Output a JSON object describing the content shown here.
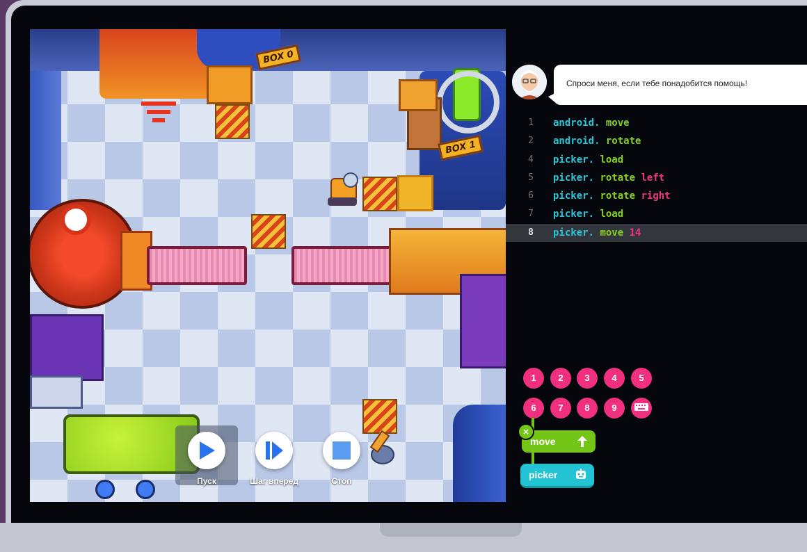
{
  "game": {
    "box_labels": [
      "BOX 0",
      "BOX 1"
    ],
    "controls": [
      {
        "label": "Пуск",
        "icon": "play-icon"
      },
      {
        "label": "Шаг вперед",
        "icon": "step-forward-icon"
      },
      {
        "label": "Стоп",
        "icon": "stop-icon"
      }
    ]
  },
  "assistant": {
    "message": "Спроси меня, если тебе понадобится помощь!",
    "icon": "professor-avatar"
  },
  "code": {
    "lines": [
      {
        "num": "1",
        "obj": "android.",
        "method": "move",
        "arg": ""
      },
      {
        "num": "2",
        "obj": "android.",
        "method": "rotate",
        "arg": ""
      },
      {
        "num": "4",
        "obj": "picker.",
        "method": "load",
        "arg": ""
      },
      {
        "num": "5",
        "obj": "picker.",
        "method": "rotate",
        "arg": "left"
      },
      {
        "num": "6",
        "obj": "picker.",
        "method": "rotate",
        "arg": "right"
      },
      {
        "num": "7",
        "obj": "picker.",
        "method": "load",
        "arg": ""
      },
      {
        "num": "8",
        "obj": "picker.",
        "method": "move",
        "arg": "14"
      }
    ],
    "active_line": "8"
  },
  "keypad": {
    "keys": [
      "1",
      "2",
      "3",
      "4",
      "5",
      "6",
      "7",
      "8",
      "9"
    ],
    "keyboard_icon": "keyboard-icon"
  },
  "blocks": {
    "move_label": "move",
    "move_icon": "arrow-up-icon",
    "picker_label": "picker",
    "picker_icon": "robot-icon",
    "close_icon": "close-icon"
  },
  "colors": {
    "object": "#28c6d7",
    "method": "#86d21c",
    "argument": "#f0357e",
    "key": "#f0307f",
    "move_block": "#73c516",
    "picker_block": "#22c3d3"
  }
}
